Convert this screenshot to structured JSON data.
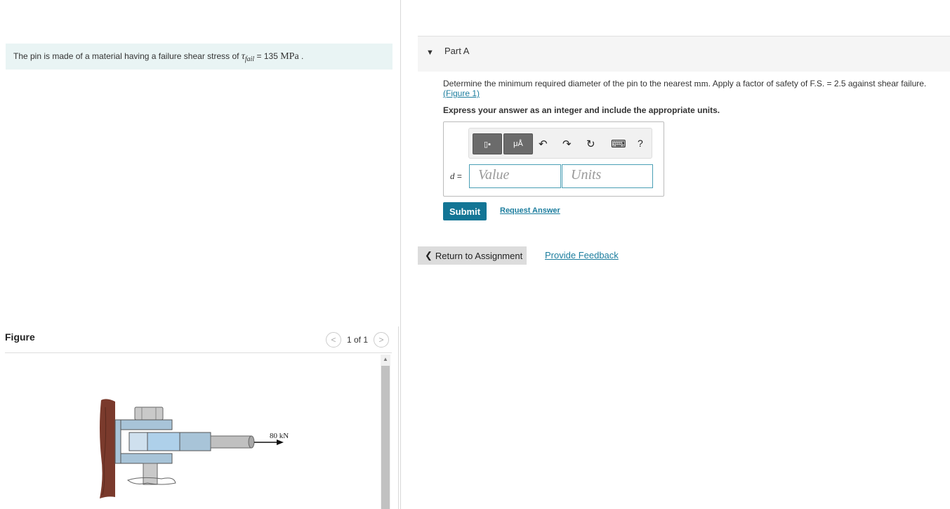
{
  "problem": {
    "text_before": "The pin is made of a material having a failure shear stress of ",
    "symbol": "τ",
    "subscript": "fail",
    "equals": " = 135 ",
    "unit": "MPa",
    "period": " ."
  },
  "figure": {
    "title": "Figure",
    "pager": "1 of 1",
    "prev_symbol": "<",
    "next_symbol": ">",
    "force_label": "80 kN"
  },
  "part": {
    "caret": "▼",
    "title": "Part A",
    "question_before": "Determine the minimum required diameter of the pin to the nearest ",
    "question_unit": "mm",
    "question_after": ". Apply a factor of safety of F.S. = 2.5 against shear failure.",
    "figure_link": "(Figure 1)",
    "instructions": "Express your answer as an integer and include the appropriate units.",
    "toolbar": {
      "template_label": "▯▪",
      "units_label": "μÅ",
      "undo_symbol": "↶",
      "redo_symbol": "↷",
      "reset_symbol": "↻",
      "keyboard_symbol": "⌨",
      "help_symbol": "?"
    },
    "variable": "d",
    "equals": " =",
    "value_placeholder": "Value",
    "units_placeholder": "Units",
    "submit_label": "Submit",
    "request_label": "Request Answer"
  },
  "footer": {
    "return_label": "Return to Assignment",
    "return_icon": "❮",
    "feedback_label": "Provide Feedback"
  },
  "colors": {
    "accent": "#137595",
    "link": "#1c7d9e",
    "problem_bg": "#e9f4f4"
  }
}
